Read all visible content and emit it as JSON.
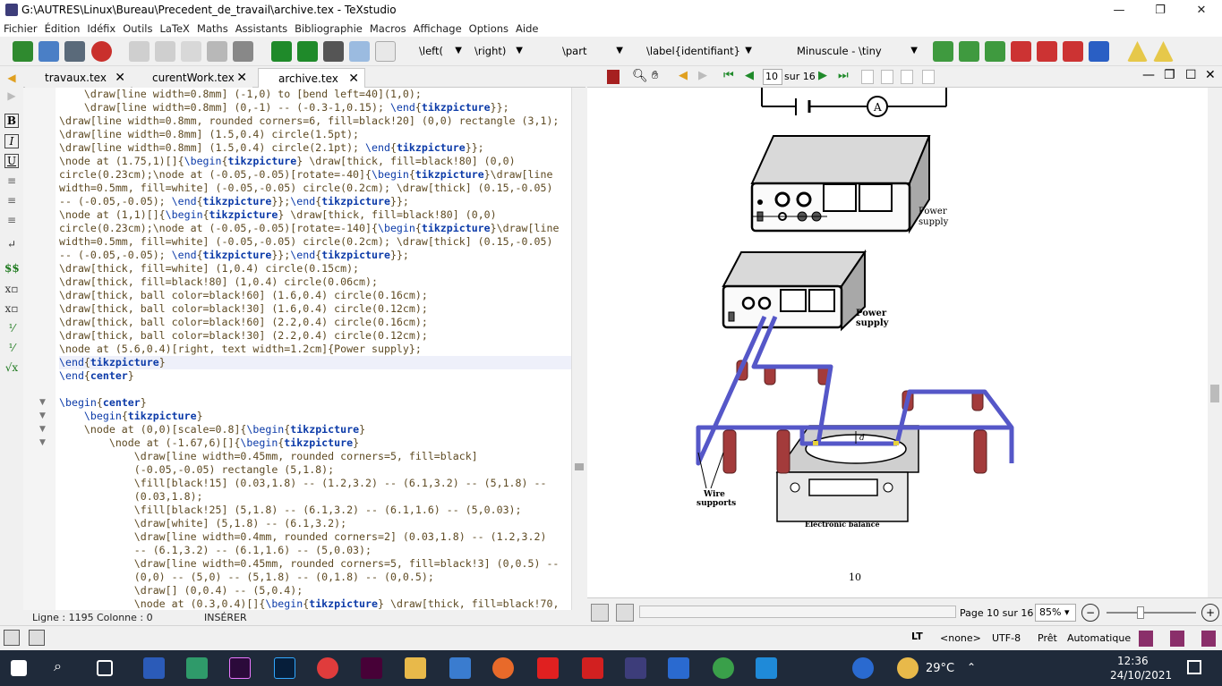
{
  "window": {
    "title": "G:\\AUTRES\\Linux\\Bureau\\Precedent_de_travail\\archive.tex - TeXstudio",
    "minimize": "—",
    "restore": "❐",
    "close": "✕"
  },
  "menu": [
    "Fichier",
    "Édition",
    "Idéfix",
    "Outils",
    "LaTeX",
    "Maths",
    "Assistants",
    "Bibliographie",
    "Macros",
    "Affichage",
    "Options",
    "Aide"
  ],
  "toolbar": {
    "left_combo": "\\left(",
    "right_combo": "\\right)",
    "part_combo": "\\part",
    "label_combo": "\\label{identifiant}",
    "size_combo": "Minuscule - \\tiny"
  },
  "tabs": [
    "travaux.tex",
    "curentWork.tex",
    "archive.tex"
  ],
  "code_lines": [
    "    \\draw[line width=0.8mm] (-1,0) to [bend left=40](1,0);",
    "    \\draw[line width=0.8mm] (0,-1) -- (-0.3-1,0.15); \\end{tikzpicture}};",
    "\\draw[line width=0.8mm, rounded corners=6, fill=black!20] (0,0) rectangle (3,1);",
    "\\draw[line width=0.8mm] (1.5,0.4) circle(1.5pt);",
    "\\draw[line width=0.8mm] (1.5,0.4) circle(2.1pt); \\end{tikzpicture}};",
    "\\node at (1.75,1)[]{\\begin{tikzpicture} \\draw[thick, fill=black!80] (0,0)",
    "circle(0.23cm);\\node at (-0.05,-0.05)[rotate=-40]{\\begin{tikzpicture}\\draw[line",
    "width=0.5mm, fill=white] (-0.05,-0.05) circle(0.2cm); \\draw[thick] (0.15,-0.05)",
    "-- (-0.05,-0.05); \\end{tikzpicture}};\\end{tikzpicture}};",
    "\\node at (1,1)[]{\\begin{tikzpicture} \\draw[thick, fill=black!80] (0,0)",
    "circle(0.23cm);\\node at (-0.05,-0.05)[rotate=-140]{\\begin{tikzpicture}\\draw[line",
    "width=0.5mm, fill=white] (-0.05,-0.05) circle(0.2cm); \\draw[thick] (0.15,-0.05)",
    "-- (-0.05,-0.05); \\end{tikzpicture}};\\end{tikzpicture}};",
    "\\draw[thick, fill=white] (1,0.4) circle(0.15cm);",
    "\\draw[thick, fill=black!80] (1,0.4) circle(0.06cm);",
    "\\draw[thick, ball color=black!60] (1.6,0.4) circle(0.16cm);",
    "\\draw[thick, ball color=black!30] (1.6,0.4) circle(0.12cm);",
    "\\draw[thick, ball color=black!60] (2.2,0.4) circle(0.16cm);",
    "\\draw[thick, ball color=black!30] (2.2,0.4) circle(0.12cm);",
    "\\node at (5.6,0.4)[right, text width=1.2cm]{Power supply};",
    "\\end{tikzpicture}",
    "\\end{center}",
    "",
    "\\begin{center}",
    "    \\begin{tikzpicture}",
    "    \\node at (0,0)[scale=0.8]{\\begin{tikzpicture}",
    "        \\node at (-1.67,6)[]{\\begin{tikzpicture}",
    "            \\draw[line width=0.45mm, rounded corners=5, fill=black]",
    "            (-0.05,-0.05) rectangle (5,1.8);",
    "            \\fill[black!15] (0.03,1.8) -- (1.2,3.2) -- (6.1,3.2) -- (5,1.8) --",
    "            (0.03,1.8);",
    "            \\fill[black!25] (5,1.8) -- (6.1,3.2) -- (6.1,1.6) -- (5,0.03);",
    "            \\draw[white] (5,1.8) -- (6.1,3.2);",
    "            \\draw[line width=0.4mm, rounded corners=2] (0.03,1.8) -- (1.2,3.2)",
    "            -- (6.1,3.2) -- (6.1,1.6) -- (5,0.03);",
    "            \\draw[line width=0.45mm, rounded corners=5, fill=black!3] (0,0.5) --",
    "            (0,0) -- (5,0) -- (5,1.8) -- (0,1.8) -- (0,0.5);",
    "            \\draw[] (0,0.4) -- (5,0.4);",
    "            \\node at (0.3,0.4)[]{\\begin{tikzpicture} \\draw[thick, fill=black!70,"
  ],
  "status": {
    "line": "Ligne : 1195",
    "column": "Colonne : 0",
    "mode": "INSÉRER"
  },
  "pdf": {
    "page_input": "10",
    "page_total": "sur 16",
    "page_indicator": "Page 10 sur 16",
    "zoom": "85%",
    "page_number": "10"
  },
  "figure": {
    "ammeter": "A",
    "power_supply_1": [
      "Power",
      "supply"
    ],
    "power_supply_2": [
      "Power",
      "supply"
    ],
    "d_label": "d",
    "wire_supports": [
      "Wire",
      "supports"
    ],
    "balance": "Electronic balance"
  },
  "statusbar": {
    "lt": "LT",
    "lang": "<none>",
    "encoding": "UTF-8",
    "ready": "Prêt",
    "mode": "Automatique"
  },
  "taskbar": {
    "temperature": "29°C",
    "time": "12:36",
    "date": "24/10/2021"
  },
  "colors": {
    "accent_blue": "#0b3aa8",
    "code_text": "#5e4a22",
    "wire_blue": "#5557c8",
    "support_red": "#a33b3b",
    "taskbar": "#1f2a3a"
  }
}
